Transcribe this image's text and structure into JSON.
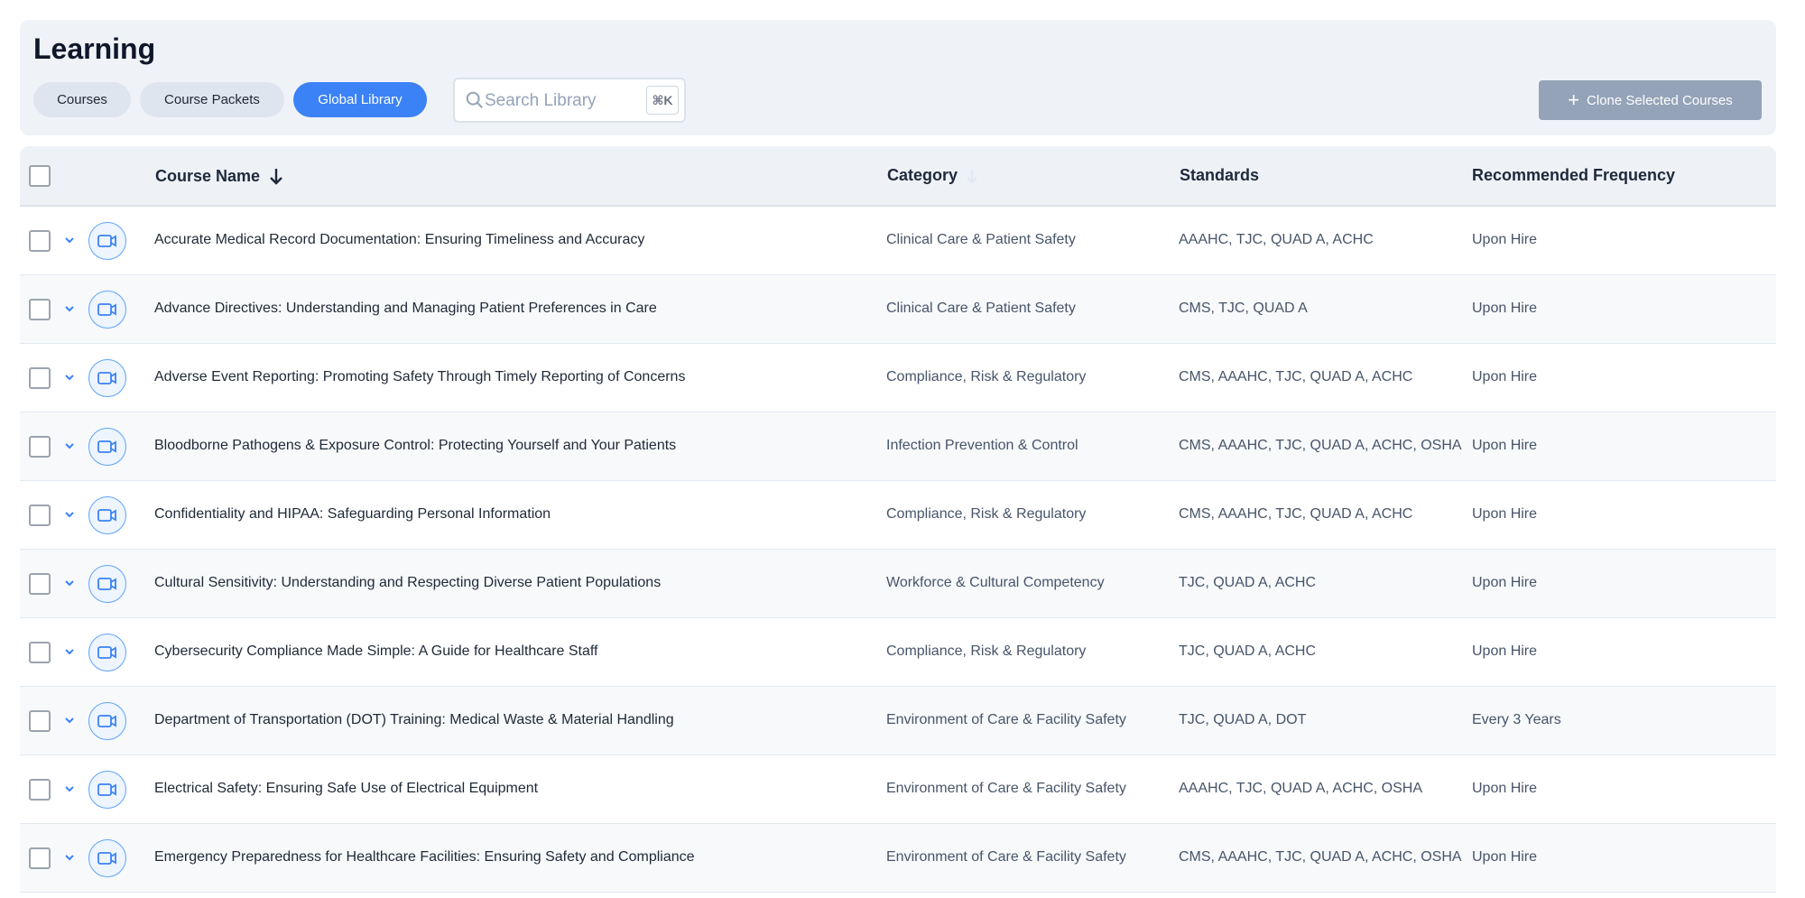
{
  "page": {
    "title": "Learning"
  },
  "tabs": [
    {
      "label": "Courses",
      "active": false
    },
    {
      "label": "Course Packets",
      "active": false
    },
    {
      "label": "Global Library",
      "active": true
    }
  ],
  "search": {
    "placeholder": "Search Library",
    "shortcut": "⌘K"
  },
  "actions": {
    "clone_label": "Clone Selected Courses"
  },
  "table": {
    "columns": {
      "name": "Course Name",
      "category": "Category",
      "standards": "Standards",
      "frequency": "Recommended Frequency"
    },
    "sort": {
      "column": "Course Name",
      "direction": "descending-arrow"
    },
    "rows": [
      {
        "name": "Accurate Medical Record Documentation: Ensuring Timeliness and Accuracy",
        "category": "Clinical Care & Patient Safety",
        "standards": "AAAHC, TJC, QUAD A, ACHC",
        "frequency": "Upon Hire"
      },
      {
        "name": "Advance Directives: Understanding and Managing Patient Preferences in Care",
        "category": "Clinical Care & Patient Safety",
        "standards": "CMS, TJC, QUAD A",
        "frequency": "Upon Hire"
      },
      {
        "name": "Adverse Event Reporting: Promoting Safety Through Timely Reporting of Concerns",
        "category": "Compliance, Risk & Regulatory",
        "standards": "CMS, AAAHC, TJC, QUAD A, ACHC",
        "frequency": "Upon Hire"
      },
      {
        "name": "Bloodborne Pathogens & Exposure Control: Protecting Yourself and Your Patients",
        "category": "Infection Prevention & Control",
        "standards": "CMS, AAAHC, TJC, QUAD A, ACHC, OSHA",
        "frequency": "Upon Hire"
      },
      {
        "name": "Confidentiality and HIPAA: Safeguarding Personal Information",
        "category": "Compliance, Risk & Regulatory",
        "standards": "CMS, AAAHC, TJC, QUAD A, ACHC",
        "frequency": "Upon Hire"
      },
      {
        "name": "Cultural Sensitivity: Understanding and Respecting Diverse Patient Populations",
        "category": "Workforce & Cultural Competency",
        "standards": "TJC, QUAD A, ACHC",
        "frequency": "Upon Hire"
      },
      {
        "name": "Cybersecurity Compliance Made Simple: A Guide for Healthcare Staff",
        "category": "Compliance, Risk & Regulatory",
        "standards": "TJC, QUAD A, ACHC",
        "frequency": "Upon Hire"
      },
      {
        "name": "Department of Transportation (DOT) Training: Medical Waste & Material Handling",
        "category": "Environment of Care & Facility Safety",
        "standards": "TJC, QUAD A, DOT",
        "frequency": "Every 3 Years"
      },
      {
        "name": "Electrical Safety: Ensuring Safe Use of Electrical Equipment",
        "category": "Environment of Care & Facility Safety",
        "standards": "AAAHC, TJC, QUAD A, ACHC, OSHA",
        "frequency": "Upon Hire"
      },
      {
        "name": "Emergency Preparedness for Healthcare Facilities: Ensuring Safety and Compliance",
        "category": "Environment of Care & Facility Safety",
        "standards": "CMS, AAAHC, TJC, QUAD A, ACHC, OSHA",
        "frequency": "Upon Hire"
      }
    ]
  },
  "colors": {
    "accent": "#3b82f6",
    "disabled_button": "#94a3b8",
    "panel": "#eff3f8"
  },
  "icons": [
    "search-icon",
    "plus-icon",
    "sort-arrow-down-icon",
    "chevron-down-icon",
    "video-icon"
  ]
}
